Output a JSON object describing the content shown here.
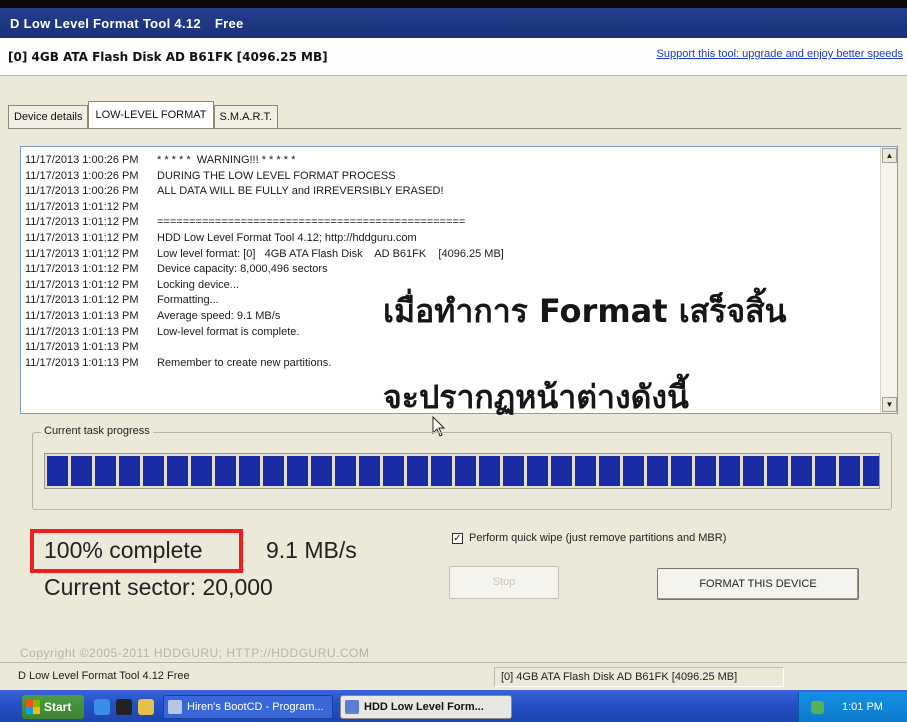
{
  "window": {
    "title": "D Low Level Format Tool 4.12",
    "edition": "Free"
  },
  "device": {
    "title": "[0]  4GB ATA Flash Disk    AD B61FK    [4096.25 MB]",
    "support_link": "Support this tool: upgrade and enjoy better speeds"
  },
  "tabs": [
    {
      "label": "Device details"
    },
    {
      "label": "LOW-LEVEL FORMAT"
    },
    {
      "label": "S.M.A.R.T."
    }
  ],
  "log": [
    {
      "ts": "11/17/2013 1:00:26 PM",
      "msg": "* * * * *  WARNING!!! * * * * *"
    },
    {
      "ts": "11/17/2013 1:00:26 PM",
      "msg": "DURING THE LOW LEVEL FORMAT PROCESS"
    },
    {
      "ts": "11/17/2013 1:00:26 PM",
      "msg": "ALL DATA WILL BE FULLY and IRREVERSIBLY ERASED!"
    },
    {
      "ts": "11/17/2013 1:01:12 PM",
      "msg": ""
    },
    {
      "ts": "11/17/2013 1:01:12 PM",
      "msg": "================================================"
    },
    {
      "ts": "11/17/2013 1:01:12 PM",
      "msg": "HDD Low Level Format Tool 4.12; http://hddguru.com"
    },
    {
      "ts": "11/17/2013 1:01:12 PM",
      "msg": "Low level format: [0]   4GB ATA Flash Disk    AD B61FK    [4096.25 MB]"
    },
    {
      "ts": "11/17/2013 1:01:12 PM",
      "msg": "Device capacity: 8,000,496 sectors"
    },
    {
      "ts": "11/17/2013 1:01:12 PM",
      "msg": "Locking device..."
    },
    {
      "ts": "11/17/2013 1:01:12 PM",
      "msg": "Formatting..."
    },
    {
      "ts": "11/17/2013 1:01:13 PM",
      "msg": "Average speed: 9.1 MB/s"
    },
    {
      "ts": "11/17/2013 1:01:13 PM",
      "msg": "Low-level format is complete."
    },
    {
      "ts": "11/17/2013 1:01:13 PM",
      "msg": ""
    },
    {
      "ts": "11/17/2013 1:01:13 PM",
      "msg": "Remember to create new partitions."
    }
  ],
  "overlay": {
    "line1": "เมื่อทำการ Format เสร็จสิ้น",
    "line2": "จะปรากฏหน้าต่างดังนี้"
  },
  "progress": {
    "legend": "Current task progress",
    "fraction": 1.0,
    "percent_label": "100% complete",
    "speed_label": "9.1 MB/s",
    "sector_label": "Current sector: 20,000"
  },
  "options": {
    "quick_wipe_label": "Perform quick wipe (just remove partitions and MBR)",
    "quick_wipe_checked": true
  },
  "buttons": {
    "stop_label": "Stop",
    "format_label": "FORMAT THIS DEVICE"
  },
  "copyright": "Copyright ©2005-2011 HDDGURU;  HTTP://HDDGURU.COM",
  "status": {
    "left": "D Low Level Format Tool 4.12   Free",
    "right": "[0]  4GB ATA Flash Disk    AD B61FK    [4096.25 MB]"
  },
  "taskbar": {
    "start_label": "Start",
    "items": [
      {
        "label": "Hiren's BootCD - Program..."
      },
      {
        "label": "HDD Low Level Form..."
      }
    ],
    "clock": "1:01 PM"
  },
  "colors": {
    "titlebar": "#1b3278",
    "progress_fill": "#1a2ca4",
    "highlight_box": "#ef1f1f",
    "taskbar": "#2552c8"
  }
}
